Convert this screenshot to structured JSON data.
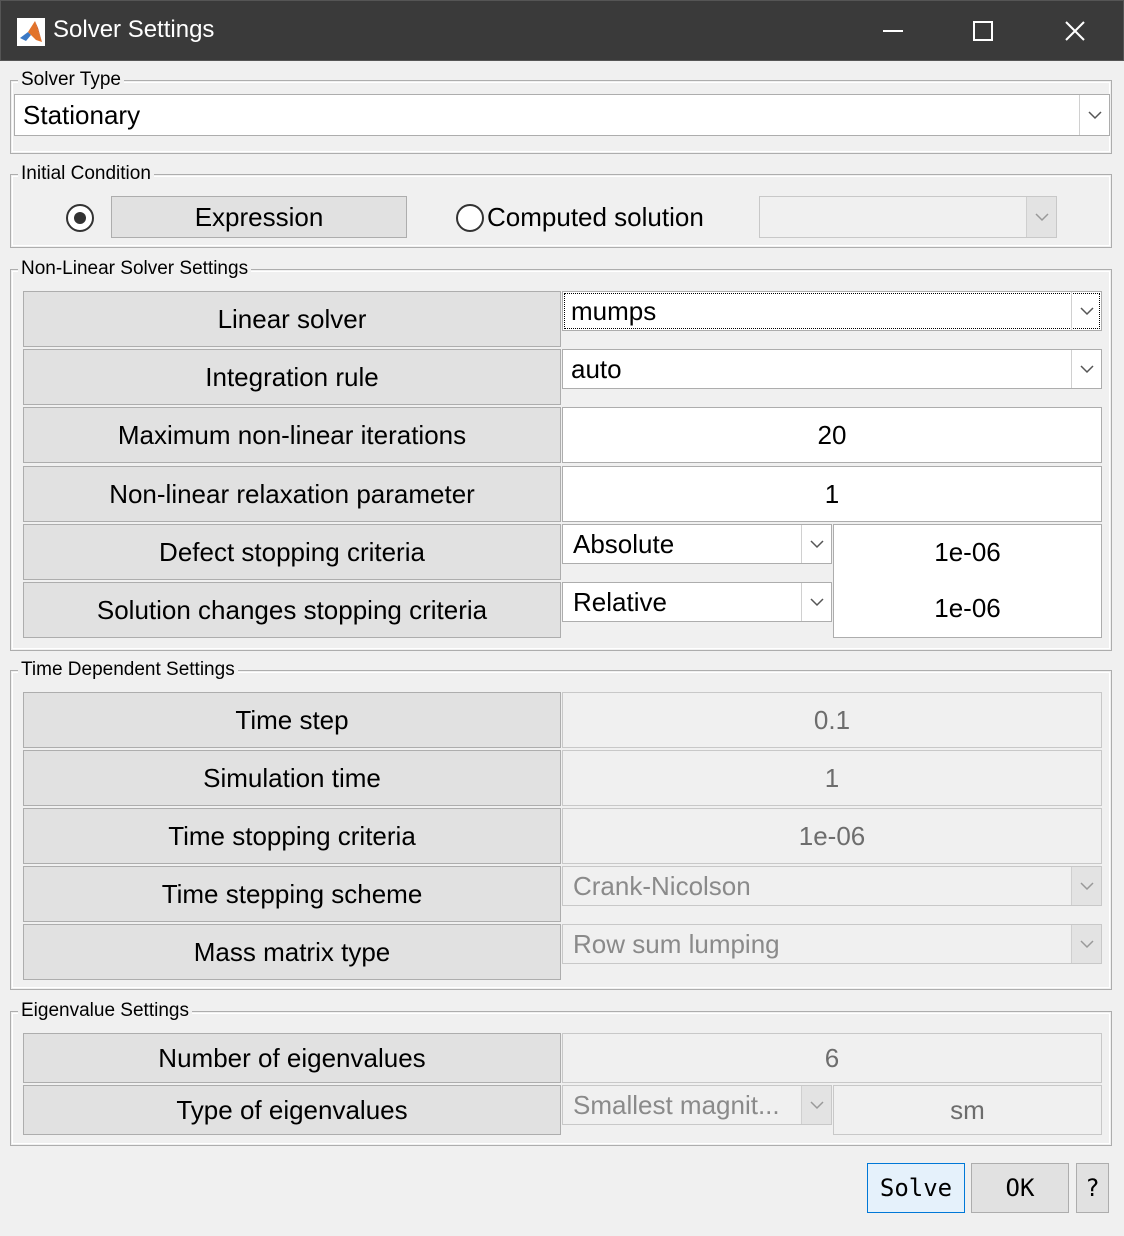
{
  "window": {
    "title": "Solver Settings"
  },
  "solver_type": {
    "group_label": "Solver Type",
    "selected": "Stationary"
  },
  "initial_condition": {
    "group_label": "Initial Condition",
    "expression_button": "Expression",
    "computed_label": "Computed solution",
    "computed_value": ""
  },
  "nonlinear": {
    "group_label": "Non-Linear Solver Settings",
    "linear_solver": {
      "label": "Linear solver",
      "value": "mumps"
    },
    "integration_rule": {
      "label": "Integration rule",
      "value": "auto"
    },
    "max_iterations": {
      "label": "Maximum non-linear iterations",
      "value": "20"
    },
    "relaxation": {
      "label": "Non-linear relaxation parameter",
      "value": "1"
    },
    "defect": {
      "label": "Defect stopping criteria",
      "mode": "Absolute",
      "value": "1e-06"
    },
    "solution_changes": {
      "label": "Solution changes stopping criteria",
      "mode": "Relative",
      "value": "1e-06"
    }
  },
  "time": {
    "group_label": "Time Dependent Settings",
    "time_step": {
      "label": "Time step",
      "value": "0.1"
    },
    "sim_time": {
      "label": "Simulation time",
      "value": "1"
    },
    "stop_criteria": {
      "label": "Time stopping criteria",
      "value": "1e-06"
    },
    "scheme": {
      "label": "Time stepping scheme",
      "value": "Crank-Nicolson"
    },
    "mass_matrix": {
      "label": "Mass matrix type",
      "value": "Row sum lumping"
    }
  },
  "eigen": {
    "group_label": "Eigenvalue Settings",
    "number": {
      "label": "Number of eigenvalues",
      "value": "6"
    },
    "type": {
      "label": "Type of eigenvalues",
      "value": "Smallest magnit...",
      "code": "sm"
    }
  },
  "buttons": {
    "solve": "Solve",
    "ok": "OK",
    "help": "?"
  },
  "colors": {
    "titlebar": "#3a3a3a",
    "panel": "#f0f0f0",
    "label_cell": "#e1e1e1",
    "default_button_border": "#0078d7"
  }
}
